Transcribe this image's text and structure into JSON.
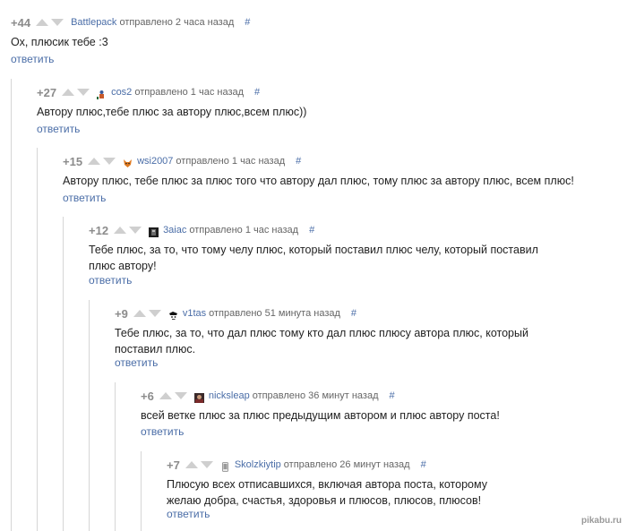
{
  "comments": [
    {
      "rating": "+44",
      "user": "Battlepack",
      "meta": "отправлено 2 часа назад",
      "hash": "#",
      "lines": [
        "Ох, плюсик тебе :3"
      ],
      "reply": "ответить",
      "avatar": "none"
    },
    {
      "rating": "+27",
      "user": "cos2",
      "meta": "отправлено 1 час назад",
      "hash": "#",
      "lines": [
        "Автору плюс,тебе плюс за автору плюс,всем плюс))"
      ],
      "reply": "ответить",
      "avatar": "figure-icon"
    },
    {
      "rating": "+15",
      "user": "wsi2007",
      "meta": "отправлено 1 час назад",
      "hash": "#",
      "lines": [
        "Автору плюс, тебе плюс за плюс того что автору дал плюс, тому плюс за автору плюс, всем плюс!"
      ],
      "reply": "ответить",
      "avatar": "fox-icon"
    },
    {
      "rating": "+12",
      "user": "3aiac",
      "meta": "отправлено 1 час назад",
      "hash": "#",
      "lines": [
        "Тебе плюс, за то, что тому челу плюс, который поставил плюс челу, который поставил",
        "плюс автору!"
      ],
      "reply": "ответить",
      "avatar": "dark-photo-icon"
    },
    {
      "rating": "+9",
      "user": "v1tas",
      "meta": "отправлено 51 минута назад",
      "hash": "#",
      "lines": [
        "Тебе плюс, за то, что дал плюс тому кто дал плюс плюсу автора плюс, который",
        "поставил плюс."
      ],
      "reply": "ответить",
      "avatar": "sketch-face-icon"
    },
    {
      "rating": "+6",
      "user": "nicksleap",
      "meta": "отправлено 36 минут назад",
      "hash": "#",
      "lines": [
        "всей ветке плюс за плюс предыдущим автором и плюс автору поста!"
      ],
      "reply": "ответить",
      "avatar": "photo-icon"
    },
    {
      "rating": "+7",
      "user": "Skolzkiytip",
      "meta": "отправлено 26 минут назад",
      "hash": "#",
      "lines": [
        "Плюсую всех отписавшихся, включая автора поста, которому",
        "желаю добра, счастья, здоровья и плюсов, плюсов, плюсов!"
      ],
      "reply": "ответить",
      "avatar": "phone-icon"
    }
  ],
  "watermark": "pikabu.ru"
}
